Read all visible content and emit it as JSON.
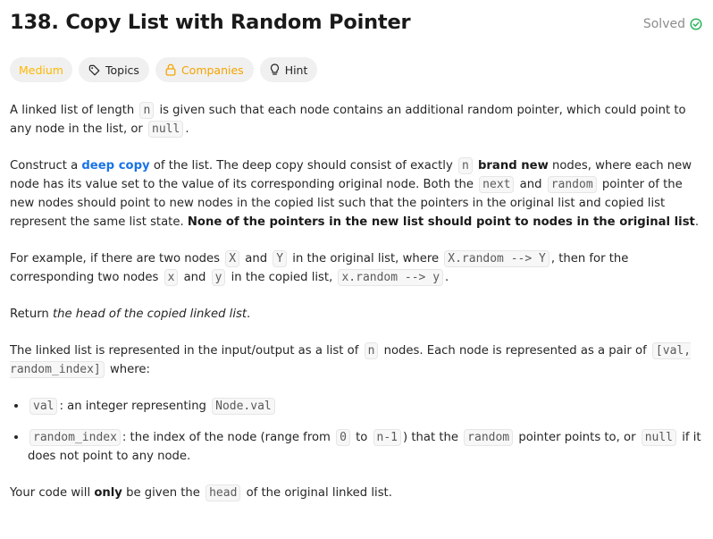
{
  "problem": {
    "title": "138. Copy List with Random Pointer",
    "status": "Solved"
  },
  "tags": {
    "difficulty": "Medium",
    "topics": "Topics",
    "companies": "Companies",
    "hint": "Hint"
  },
  "colors": {
    "medium": "#ffb800",
    "solved_check": "#2db55d",
    "link": "#1a73e8"
  },
  "icons": [
    "check-circle-icon",
    "tag-icon",
    "lock-icon",
    "lightbulb-icon"
  ],
  "desc": {
    "p1": {
      "t1": "A linked list of length ",
      "c1": "n",
      "t2": " is given such that each node contains an additional random pointer, which could point to any node in the list, or ",
      "c2": "null",
      "t3": "."
    },
    "p2": {
      "t1": "Construct a ",
      "link": "deep copy",
      "t2": " of the list. The deep copy should consist of exactly ",
      "c1": "n",
      "t3": " ",
      "b1": "brand new",
      "t4": " nodes, where each new node has its value set to the value of its corresponding original node. Both the ",
      "c2": "next",
      "t5": " and ",
      "c3": "random",
      "t6": " pointer of the new nodes should point to new nodes in the copied list such that the pointers in the original list and copied list represent the same list state. ",
      "b2": "None of the pointers in the new list should point to nodes in the original list",
      "t7": "."
    },
    "p3": {
      "t1": "For example, if there are two nodes ",
      "c1": "X",
      "t2": " and ",
      "c2": "Y",
      "t3": " in the original list, where ",
      "c3": "X.random --> Y",
      "t4": ", then for the corresponding two nodes ",
      "c4": "x",
      "t5": " and ",
      "c5": "y",
      "t6": " in the copied list, ",
      "c6": "x.random --> y",
      "t7": "."
    },
    "p4": {
      "t1": "Return ",
      "em": "the head of the copied linked list",
      "t2": "."
    },
    "p5": {
      "t1": "The linked list is represented in the input/output as a list of ",
      "c1": "n",
      "t2": " nodes. Each node is represented as a pair of ",
      "c2": "[val, random_index]",
      "t3": " where:"
    },
    "li1": {
      "c1": "val",
      "t1": ": an integer representing ",
      "c2": "Node.val"
    },
    "li2": {
      "c1": "random_index",
      "t1": ": the index of the node (range from ",
      "c2": "0",
      "t2": " to ",
      "c3": "n-1",
      "t3": ") that the ",
      "c4": "random",
      "t4": " pointer points to, or ",
      "c5": "null",
      "t5": " if it does not point to any node."
    },
    "p6": {
      "t1": "Your code will ",
      "b1": "only",
      "t2": " be given the ",
      "c1": "head",
      "t3": " of the original linked list."
    }
  }
}
